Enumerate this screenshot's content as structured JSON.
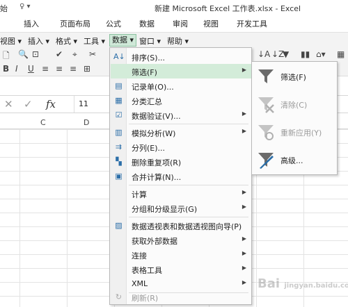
{
  "titlebar": {
    "quick_access": "始",
    "quick_access_symbol": "♀ ▾",
    "title": "新建 Microsoft Excel 工作表.xlsx - Excel"
  },
  "ribbon_tabs": [
    "插入",
    "页面布局",
    "公式",
    "数据",
    "审阅",
    "视图",
    "开发工具"
  ],
  "menubar": {
    "items": [
      {
        "label": "视图 ▾"
      },
      {
        "label": "插入 ▾"
      },
      {
        "label": "格式 ▾"
      },
      {
        "label": "工具 ▾"
      },
      {
        "label": "数据 ▾"
      },
      {
        "label": "窗口 ▾"
      },
      {
        "label": "帮助 ▾"
      }
    ]
  },
  "formula_bar": {
    "cancel_symbol": "✕",
    "confirm_symbol": "✓",
    "fx_symbol": "fx",
    "value": "11"
  },
  "columns": [
    "C",
    "D"
  ],
  "data_menu": {
    "items": [
      {
        "label": "排序(S)...",
        "icon": "sort-az-icon",
        "submenu": false
      },
      {
        "label": "筛选(F)",
        "icon": "none",
        "submenu": true,
        "hover": true
      },
      {
        "label": "记录单(O)...",
        "icon": "form-icon",
        "submenu": false
      },
      {
        "label": "分类汇总",
        "icon": "subtotal-icon",
        "submenu": false
      },
      {
        "label": "数据验证(V)...",
        "icon": "validation-icon",
        "submenu": true
      },
      {
        "label": "模拟分析(W)",
        "icon": "what-if-icon",
        "submenu": true
      },
      {
        "label": "分列(E)...",
        "icon": "text-to-columns-icon",
        "submenu": false
      },
      {
        "label": "删除重复项(R)",
        "icon": "remove-duplicates-icon",
        "submenu": false
      },
      {
        "label": "合并计算(N)...",
        "icon": "consolidate-icon",
        "submenu": false
      },
      {
        "label": "计算",
        "icon": "none",
        "submenu": true
      },
      {
        "label": "分组和分级显示(G)",
        "icon": "none",
        "submenu": true
      },
      {
        "label": "数据透视表和数据透视图向导(P)",
        "icon": "pivot-icon",
        "submenu": false
      },
      {
        "label": "获取外部数据",
        "icon": "none",
        "submenu": true
      },
      {
        "label": "连接",
        "icon": "none",
        "submenu": true
      },
      {
        "label": "表格工具",
        "icon": "none",
        "submenu": true
      },
      {
        "label": "XML",
        "icon": "none",
        "submenu": true
      },
      {
        "label": "刷新(R)",
        "icon": "refresh-icon",
        "submenu": false,
        "disabled": true
      }
    ]
  },
  "filter_submenu": {
    "items": [
      {
        "label": "筛选(F)",
        "icon": "filter-icon",
        "disabled": false
      },
      {
        "label": "清除(C)",
        "icon": "clear-filter-icon",
        "disabled": true
      },
      {
        "label": "重新应用(Y)",
        "icon": "reapply-filter-icon",
        "disabled": true
      },
      {
        "label": "高级...",
        "icon": "advanced-filter-icon",
        "disabled": false
      }
    ]
  },
  "watermark": {
    "text": "Bai",
    "sub": "jingyan.baidu.com"
  },
  "colors": {
    "hover": "#d3ecd9",
    "accent_green": "#8bc19f",
    "icon_gray": "#6b6b6b"
  }
}
